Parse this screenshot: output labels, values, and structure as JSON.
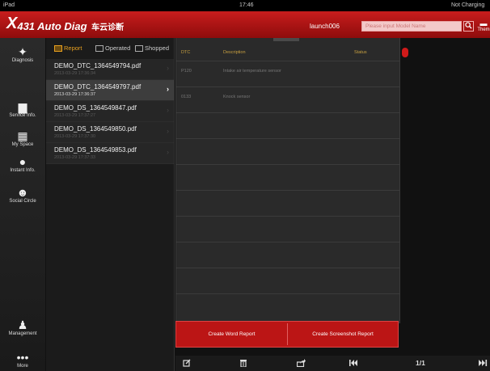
{
  "status_bar": {
    "left": "iPad",
    "time": "17:46",
    "right": "Not Charging"
  },
  "header": {
    "logo_x": "X",
    "logo_text": "431 Auto Diag",
    "logo_sub": "车云诊断",
    "username": "launch006",
    "search_placeholder": "Please input Model Name",
    "search_icon": "magnifier",
    "right_label": "Them"
  },
  "sidebar": {
    "items": [
      {
        "label": "Diagnosis",
        "icon": "wrench"
      },
      {
        "label": "Service Info.",
        "icon": "briefcase"
      },
      {
        "label": "My Space",
        "icon": "calendar"
      },
      {
        "label": "Instant Info.",
        "icon": "chat-bubble"
      },
      {
        "label": "Social Circle",
        "icon": "smiley"
      },
      {
        "label": "Management",
        "icon": "person"
      },
      {
        "label": "More",
        "icon": "dots"
      }
    ]
  },
  "file_tabs": [
    {
      "label": "Report",
      "active": true
    },
    {
      "label": "Operated",
      "active": false
    },
    {
      "label": "Shopped",
      "active": false
    }
  ],
  "files": [
    {
      "name": "DEMO_DTC_1364549794.pdf",
      "date": "2013-03-29 17:36:34",
      "selected": false
    },
    {
      "name": "DEMO_DTC_1364549797.pdf",
      "date": "2013-03-29 17:36:37",
      "selected": true
    },
    {
      "name": "DEMO_DS_1364549847.pdf",
      "date": "2013-03-29 17:37:27",
      "selected": false
    },
    {
      "name": "DEMO_DS_1364549850.pdf",
      "date": "2013-03-29 17:37:30",
      "selected": false
    },
    {
      "name": "DEMO_DS_1364549853.pdf",
      "date": "2013-03-29 17:37:33",
      "selected": false
    }
  ],
  "detail_table": {
    "headers": [
      "DTC",
      "Description",
      "Status"
    ],
    "rows": [
      [
        "P120",
        "Intake air temperature sensor",
        ""
      ],
      [
        "0133",
        "Knock sensor",
        ""
      ]
    ]
  },
  "buttons": {
    "word": "Create Word Report",
    "screenshot": "Create Screenshot Report"
  },
  "toolbar": {
    "edit_icon": "edit",
    "delete_icon": "trash",
    "share_icon": "share",
    "first_icon": "first-page",
    "page": "1/1",
    "last_icon": "last-page"
  },
  "colors": {
    "accent_red": "#c81d1d",
    "tab_active": "#e8a020"
  }
}
